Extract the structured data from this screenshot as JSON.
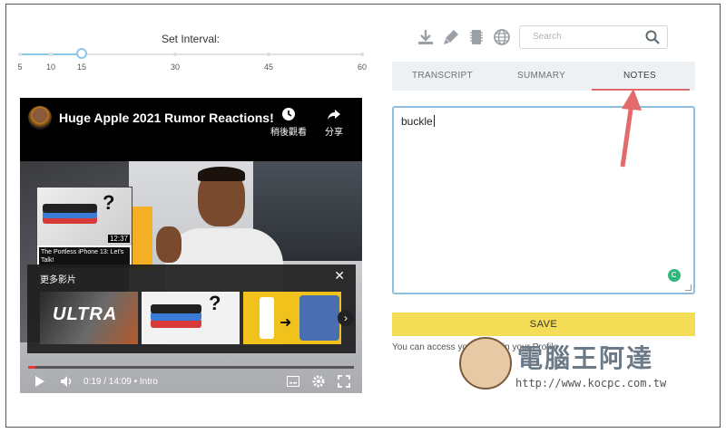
{
  "interval": {
    "title": "Set Interval:",
    "ticks": [
      "5",
      "10",
      "15",
      "30",
      "45",
      "60"
    ],
    "selected": "15"
  },
  "video": {
    "title": "Huge Apple 2021 Rumor Reactions!",
    "watch_later": "稍後觀看",
    "share": "分享",
    "card": {
      "title": "The Portless iPhone 13: Let's Talk!",
      "duration": "12:37"
    },
    "more_videos": "更多影片",
    "ultra_text": "ULTRA",
    "time": "0:19 / 14:09 • Intro",
    "progress": 0.022
  },
  "search": {
    "placeholder": "Search"
  },
  "tabs": [
    "TRANSCRIPT",
    "SUMMARY",
    "NOTES"
  ],
  "active_tab": "NOTES",
  "notes": {
    "text": "buckle"
  },
  "save_label": "SAVE",
  "info": "You can access your notes in your Profile.",
  "watermark": {
    "title": "電腦王阿達",
    "url": "http://www.kocpc.com.tw"
  },
  "colors": {
    "accent": "#8fbfe0",
    "save": "#f3dd56",
    "arrow": "#e36b6b",
    "progress": "#e53935"
  }
}
